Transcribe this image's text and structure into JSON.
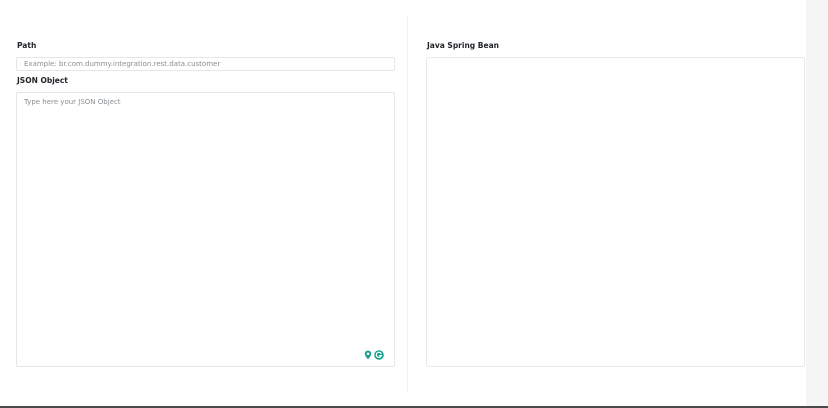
{
  "path": {
    "label": "Path",
    "placeholder": "Example: br.com.dummy.integration.rest.data.customer",
    "value": ""
  },
  "json_object": {
    "label": "JSON Object",
    "placeholder": "Type here your JSON Object",
    "value": ""
  },
  "java_spring_bean": {
    "label": "Java Spring Bean",
    "output": ""
  },
  "assist_icons": [
    "location-pin-icon",
    "grammar-assistant-icon"
  ],
  "colors": {
    "accent": "#1a9b8c",
    "border": "#e4e6e8",
    "placeholder": "#8a8f94"
  }
}
